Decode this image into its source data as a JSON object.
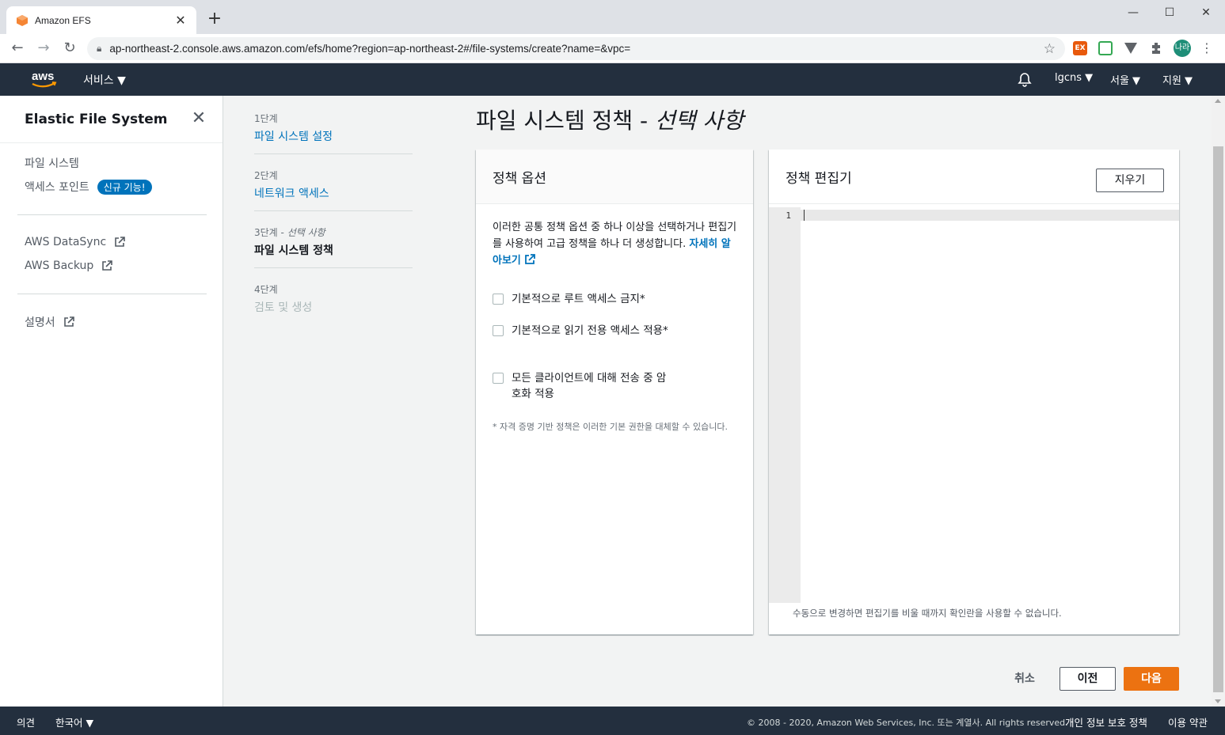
{
  "browser": {
    "tab_title": "Amazon EFS",
    "tab_close": "✕",
    "new_tab": "+",
    "url": "ap-northeast-2.console.aws.amazon.com/efs/home?region=ap-northeast-2#/file-systems/create?name=&vpc=",
    "profile_label": "나라",
    "extensions": [
      {
        "name": "ex-extension-icon",
        "label": "EX",
        "color": "#e8590c"
      },
      {
        "name": "green-extension-icon",
        "label": "",
        "color": "#34a853"
      },
      {
        "name": "v-extension-icon",
        "label": "",
        "color": "#5f6368"
      }
    ]
  },
  "aws_header": {
    "logo_text": "aws",
    "services": "서비스 ▼",
    "account": "lgcns ▼",
    "region": "서울 ▼",
    "support": "지원 ▼"
  },
  "sidebar": {
    "title": "Elastic File System",
    "items": [
      {
        "label": "파일 시스템"
      },
      {
        "label": "액세스 포인트",
        "badge": "신규 기능!"
      }
    ],
    "external": [
      {
        "label": "AWS DataSync"
      },
      {
        "label": "AWS Backup"
      }
    ],
    "docs": {
      "label": "설명서"
    }
  },
  "steps": [
    {
      "num": "1단계",
      "label": "파일 시스템 설정",
      "state": "link"
    },
    {
      "num": "2단계",
      "label": "네트워크 액세스",
      "state": "link"
    },
    {
      "num": "3단계 - ",
      "num_opt": "선택 사항",
      "label": "파일 시스템 정책",
      "state": "current"
    },
    {
      "num": "4단계",
      "label": "검토 및 생성",
      "state": "disabled"
    }
  ],
  "main": {
    "title": "파일 시스템 정책 - ",
    "title_optional": "선택 사항",
    "policy_options": {
      "heading": "정책 옵션",
      "description": "이러한 공통 정책 옵션 중 하나 이상을 선택하거나 편집기를 사용하여 고급 정책을 하나 더 생성합니다.",
      "learn_more": "자세히 알아보기",
      "checkboxes": [
        {
          "label": "기본적으로 루트 액세스 금지*",
          "checked": false
        },
        {
          "label": "기본적으로 읽기 전용 액세스 적용*",
          "checked": false
        },
        {
          "label": "모든 클라이언트에 대해 전송 중 암호화 적용",
          "checked": false
        }
      ],
      "footnote": "* 자격 증명 기반 정책은 이러한 기본 권한을 대체할 수 있습니다."
    },
    "policy_editor": {
      "heading": "정책 편집기",
      "clear_button": "지우기",
      "line_number": "1",
      "note": "수동으로 변경하면 편집기를 비울 때까지 확인란을 사용할 수 없습니다."
    },
    "buttons": {
      "cancel": "취소",
      "previous": "이전",
      "next": "다음"
    }
  },
  "footer": {
    "feedback": "의견",
    "language": "한국어 ▼",
    "copyright": "© 2008 - 2020, Amazon Web Services, Inc. 또는 계열사. All rights reserved.",
    "privacy": "개인 정보 보호 정책",
    "terms": "이용 약관"
  },
  "colors": {
    "aws_navy": "#232f3e",
    "link_blue": "#0073bb",
    "primary_orange": "#ec7211"
  }
}
